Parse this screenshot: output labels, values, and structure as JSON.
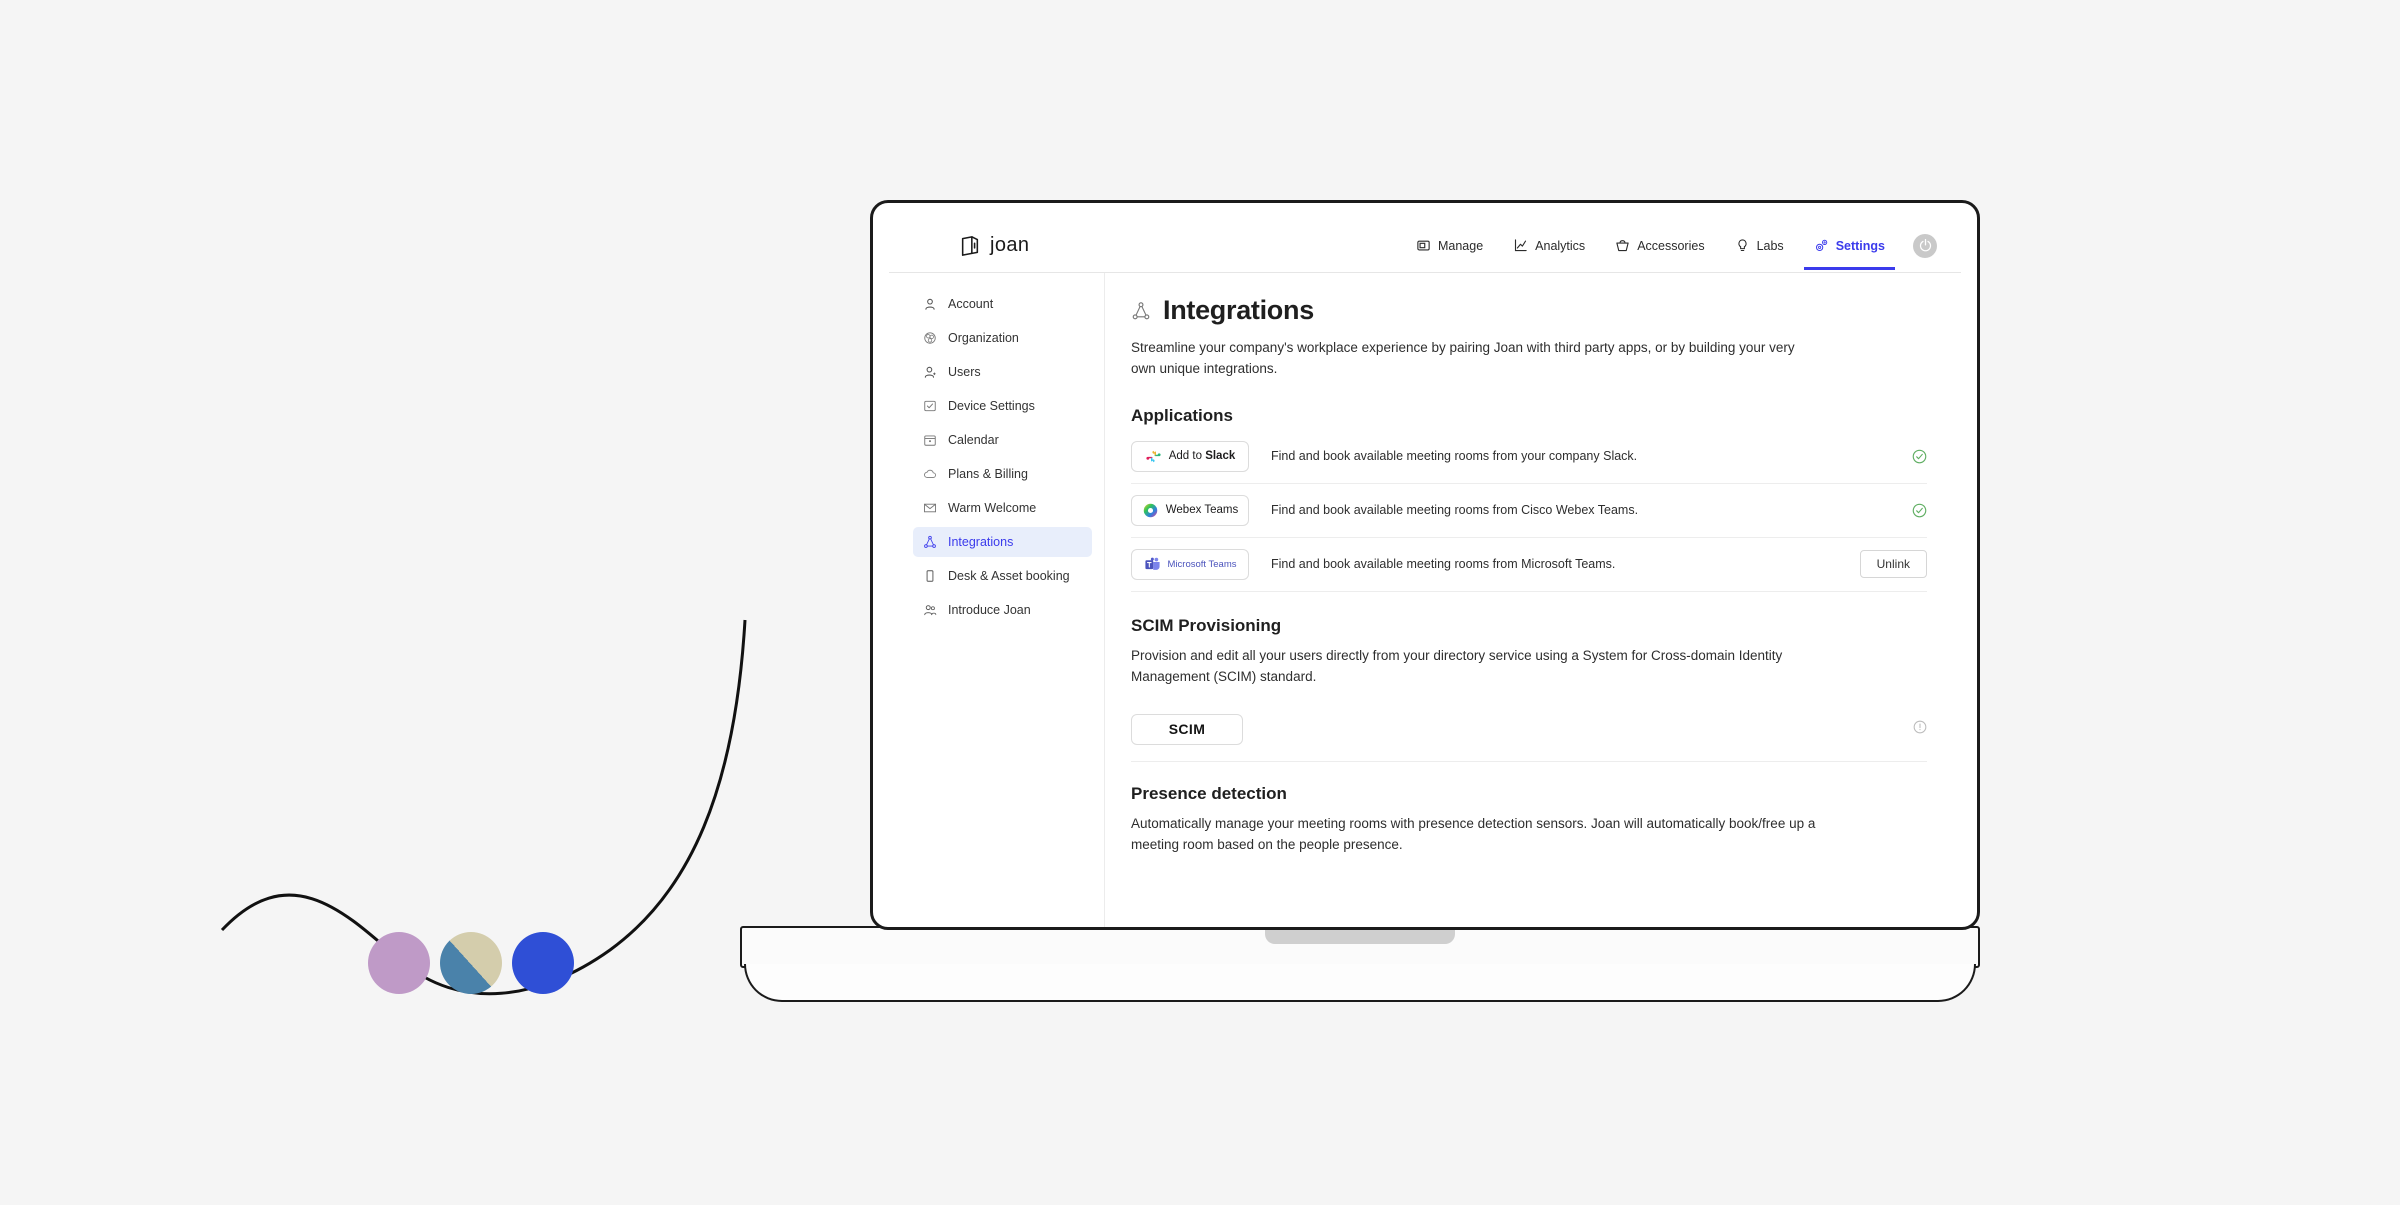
{
  "brand": {
    "name": "joan",
    "logo_icon": "joan-logo-icon"
  },
  "topnav": {
    "items": [
      {
        "label": "Manage",
        "icon": "manage-icon",
        "active": false
      },
      {
        "label": "Analytics",
        "icon": "analytics-icon",
        "active": false
      },
      {
        "label": "Accessories",
        "icon": "accessories-icon",
        "active": false
      },
      {
        "label": "Labs",
        "icon": "labs-icon",
        "active": false
      },
      {
        "label": "Settings",
        "icon": "settings-gears-icon",
        "active": true
      }
    ],
    "power_icon": "power-icon",
    "active_color": "#3b3bec"
  },
  "sidebar": {
    "items": [
      {
        "label": "Account",
        "icon": "user-icon",
        "active": false
      },
      {
        "label": "Organization",
        "icon": "organization-icon",
        "active": false
      },
      {
        "label": "Users",
        "icon": "users-icon",
        "active": false
      },
      {
        "label": "Device Settings",
        "icon": "device-check-icon",
        "active": false
      },
      {
        "label": "Calendar",
        "icon": "calendar-icon",
        "active": false
      },
      {
        "label": "Plans & Billing",
        "icon": "cloud-icon",
        "active": false
      },
      {
        "label": "Warm Welcome",
        "icon": "envelope-icon",
        "active": false
      },
      {
        "label": "Integrations",
        "icon": "integrations-icon",
        "active": true
      },
      {
        "label": "Desk & Asset booking",
        "icon": "tablet-icon",
        "active": false
      },
      {
        "label": "Introduce Joan",
        "icon": "introduce-icon",
        "active": false
      }
    ],
    "active_bg": "#e8eefb",
    "active_color": "#3b3bec"
  },
  "page": {
    "icon": "integrations-icon",
    "title": "Integrations",
    "intro": "Streamline your company's workplace experience by pairing Joan with third party apps, or by building your very own unique integrations."
  },
  "applications": {
    "heading": "Applications",
    "rows": [
      {
        "button_label_prefix": "Add to ",
        "button_label_strong": "Slack",
        "logo_icon": "slack-logo-icon",
        "description": "Find and book available meeting rooms from your company Slack.",
        "status": "connected",
        "status_icon": "check-circle-icon"
      },
      {
        "button_label_prefix": "",
        "button_label_strong": "Webex Teams",
        "logo_icon": "webex-logo-icon",
        "description": "Find and book available meeting rooms from Cisco Webex Teams.",
        "status": "connected",
        "status_icon": "check-circle-icon"
      },
      {
        "button_label_prefix": "",
        "button_label_strong": "Microsoft Teams",
        "logo_icon": "microsoft-teams-logo-icon",
        "description": "Find and book available meeting rooms from Microsoft Teams.",
        "status": "unlink",
        "action_label": "Unlink"
      }
    ],
    "connected_color": "#5fae62"
  },
  "scim": {
    "heading": "SCIM Provisioning",
    "description": "Provision and edit all your users directly from your directory service using a System for Cross-domain Identity Management (SCIM) standard.",
    "button_label": "SCIM",
    "status_icon": "info-circle-icon"
  },
  "presence": {
    "heading": "Presence detection",
    "description": "Automatically manage your meeting rooms with presence detection sensors. Joan will automatically book/free up a meeting room based on the people presence."
  },
  "decoration": {
    "circles": [
      {
        "name": "circle-purple",
        "color": "#bf9ac7"
      },
      {
        "name": "circle-split",
        "color": "#4a82aa",
        "color2": "#d4cdac"
      },
      {
        "name": "circle-blue",
        "color": "#2f4fd6"
      }
    ],
    "curve": "wave-line"
  }
}
